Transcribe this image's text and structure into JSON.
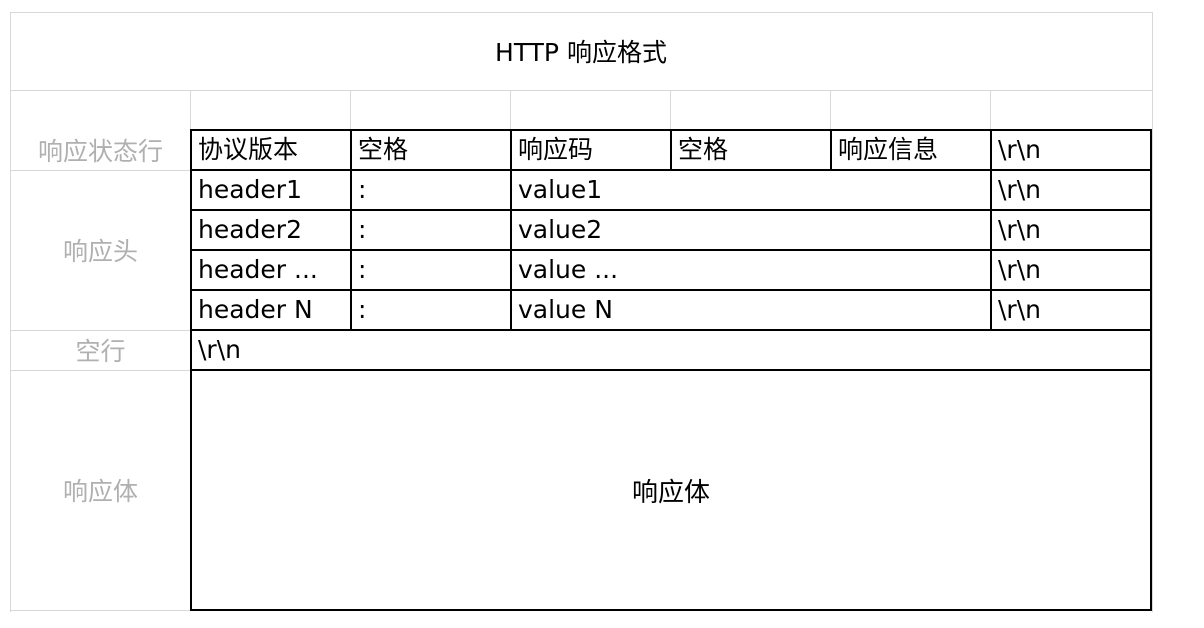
{
  "title": "HTTP 响应格式",
  "row_labels": {
    "status_line": "响应状态行",
    "headers": "响应头",
    "blank_line": "空行",
    "body": "响应体"
  },
  "status_line": [
    "协议版本",
    "空格",
    "响应码",
    "空格",
    "响应信息",
    "\\r\\n"
  ],
  "headers": [
    {
      "name": "header1",
      "sep": ":",
      "value": "value1",
      "end": "\\r\\n"
    },
    {
      "name": "header2",
      "sep": ":",
      "value": "value2",
      "end": "\\r\\n"
    },
    {
      "name": "header ...",
      "sep": ":",
      "value": "value ...",
      "end": "\\r\\n"
    },
    {
      "name": "header N",
      "sep": ":",
      "value": "value N",
      "end": "\\r\\n"
    }
  ],
  "blank_line": "\\r\\n",
  "body_label": "响应体"
}
